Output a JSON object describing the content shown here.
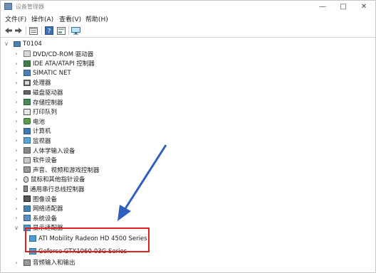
{
  "window": {
    "title": "设备管理器"
  },
  "menu": [
    "文件(F)",
    "操作(A)",
    "查看(V)",
    "帮助(H)"
  ],
  "tree": {
    "root": "T0104",
    "categories": [
      {
        "label": "DVD/CD-ROM 驱动器",
        "icon": "disc-drive-icon"
      },
      {
        "label": "IDE ATA/ATAPI 控制器",
        "icon": "ide-controller-icon"
      },
      {
        "label": "SIMATIC NET",
        "icon": "network-icon"
      },
      {
        "label": "处理器",
        "icon": "processor-icon"
      },
      {
        "label": "磁盘驱动器",
        "icon": "disk-drive-icon"
      },
      {
        "label": "存储控制器",
        "icon": "storage-controller-icon"
      },
      {
        "label": "打印队列",
        "icon": "printer-icon"
      },
      {
        "label": "电池",
        "icon": "battery-icon"
      },
      {
        "label": "计算机",
        "icon": "computer-icon"
      },
      {
        "label": "监视器",
        "icon": "monitor-icon"
      },
      {
        "label": "人体学输入设备",
        "icon": "hid-icon"
      },
      {
        "label": "软件设备",
        "icon": "software-device-icon"
      },
      {
        "label": "声音、视频和游戏控制器",
        "icon": "speaker-icon"
      },
      {
        "label": "鼠标和其他指针设备",
        "icon": "mouse-icon"
      },
      {
        "label": "通用串行总线控制器",
        "icon": "usb-icon"
      },
      {
        "label": "图像设备",
        "icon": "camera-icon"
      },
      {
        "label": "网络适配器",
        "icon": "network-adapter-icon"
      },
      {
        "label": "系统设备",
        "icon": "system-device-icon"
      },
      {
        "label": "显示适配器",
        "icon": "display-adapter-icon",
        "expanded": true
      },
      {
        "label": "音频输入和输出",
        "icon": "audio-io-icon"
      }
    ],
    "display_adapters": [
      "ATI Mobility Radeon HD 4500 Series",
      "Geforce GTX1060-03G Series"
    ]
  },
  "colors": {
    "highlight": "#e02020",
    "arrow": "#2f5fbf"
  }
}
